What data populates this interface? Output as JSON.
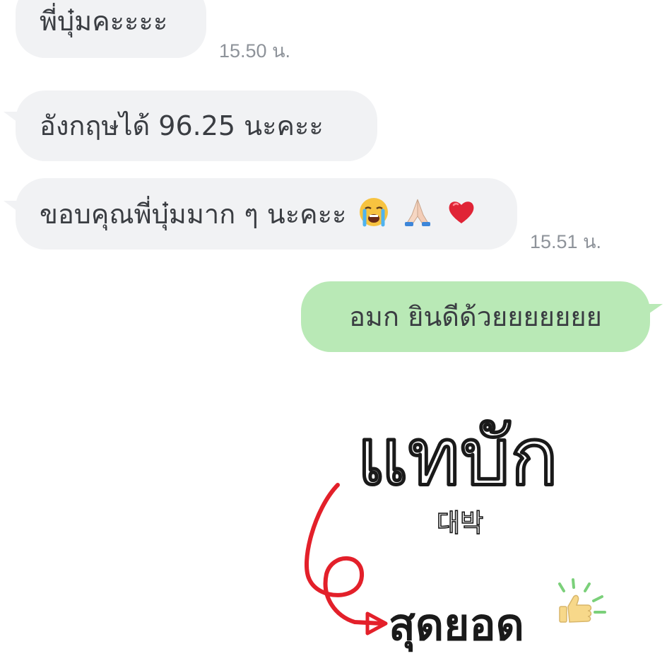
{
  "messages": [
    {
      "id": "m1",
      "direction": "incoming",
      "text": "พี่บุ๋มคะะะะ",
      "time": "15.50 น."
    },
    {
      "id": "m2",
      "direction": "incoming",
      "text": "อังกฤษได้ 96.25 นะคะะ",
      "time": ""
    },
    {
      "id": "m3",
      "direction": "incoming",
      "text": "ขอบคุณพี่บุ๋มมาก ๆ นะคะะ",
      "emojis": [
        "crying-face-emoji",
        "folded-hands-emoji",
        "red-heart-emoji"
      ],
      "time": "15.51 น."
    },
    {
      "id": "m4",
      "direction": "outgoing",
      "text": "อมก ยินดีด้วยยยยยยย",
      "time": ""
    }
  ],
  "sticker": {
    "headline": "แทบัก",
    "korean": "대박",
    "caption": "สุดยอด",
    "icons": [
      "thumbs-up-icon",
      "sparkle-lines"
    ],
    "colors": {
      "ink": "#1a1a1a",
      "arrow": "#e3202a",
      "accent": "#7bd07a",
      "thumb": "#f7d88a"
    }
  },
  "colors": {
    "incoming_bubble": "#f1f2f4",
    "outgoing_bubble": "#b9e9b6",
    "text": "#3a3d42",
    "timestamp": "#8e939a"
  }
}
